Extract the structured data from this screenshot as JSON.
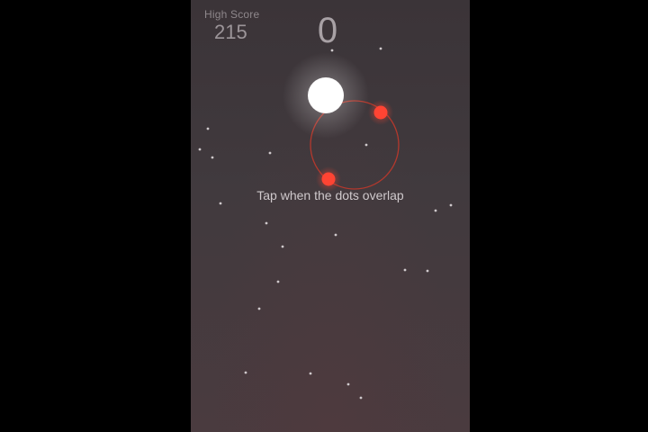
{
  "game": {
    "high_score_label": "High Score",
    "high_score_value": "215",
    "current_score": "0",
    "instruction": "Tap when the dots overlap"
  },
  "colors": {
    "background_top": "#3b3438",
    "background_bottom": "#4a3b3f",
    "ball": "#ffffff",
    "ring": "#c0392b",
    "orbit_dot": "#ff4433",
    "star": "#cfc9cc"
  },
  "icons": {
    "ball": "white-ball",
    "orbit": "red-orbit-ring",
    "orbit_dots": "red-dot"
  }
}
